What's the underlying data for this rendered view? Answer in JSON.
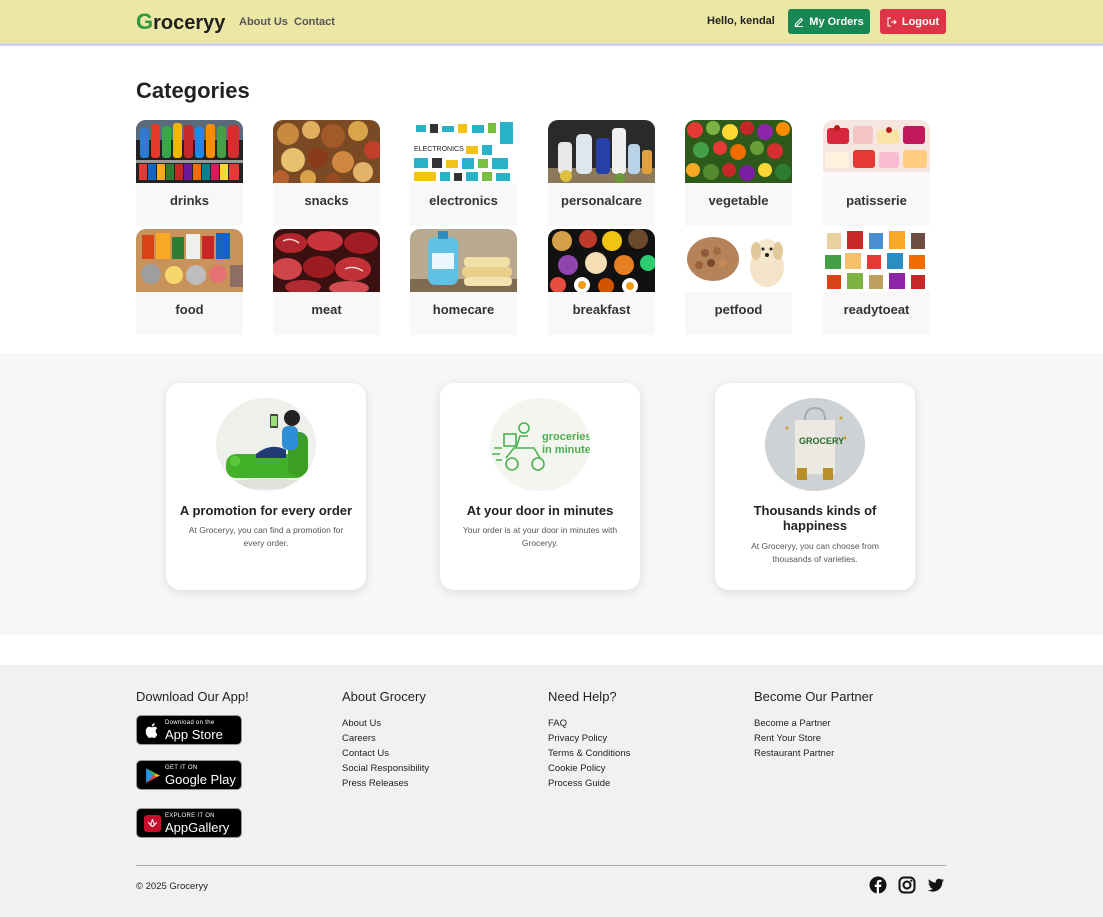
{
  "navbar": {
    "brand_first": "G",
    "brand_rest": "roceryy",
    "links": [
      "About Us",
      "Contact"
    ],
    "greeting": "Hello, kendal",
    "orders_label": "My Orders",
    "logout_label": "Logout"
  },
  "categories": {
    "title": "Categories",
    "items": [
      {
        "label": "drinks"
      },
      {
        "label": "snacks"
      },
      {
        "label": "electronics",
        "image_text": "ELECTRONICS"
      },
      {
        "label": "personalcare"
      },
      {
        "label": "vegetable"
      },
      {
        "label": "patisserie"
      },
      {
        "label": "food"
      },
      {
        "label": "meat"
      },
      {
        "label": "homecare"
      },
      {
        "label": "breakfast"
      },
      {
        "label": "petfood"
      },
      {
        "label": "readytoeat"
      }
    ]
  },
  "features": [
    {
      "title": "A promotion for every order",
      "desc": "At Groceryy, you can find a promotion for every order."
    },
    {
      "title": "At your door in minutes",
      "desc": "Your order is at your door in minutes with Groceryy.",
      "image_text_1": "groceries",
      "image_text_2": "in minutes"
    },
    {
      "title": "Thousands kinds of happiness",
      "desc": "At Groceryy, you can choose from thousands of varieties.",
      "image_text": "GROCERY"
    }
  ],
  "footer": {
    "app": {
      "heading": "Download Our App!",
      "stores": [
        {
          "small": "Download on the",
          "big": "App Store",
          "icon": "apple-icon"
        },
        {
          "small": "GET IT ON",
          "big": "Google Play",
          "icon": "google-play-icon"
        },
        {
          "small": "EXPLORE IT ON",
          "big": "AppGallery",
          "icon": "huawei-icon"
        }
      ]
    },
    "about": {
      "heading": "About Grocery",
      "links": [
        "About Us",
        "Careers",
        "Contact Us",
        "Social Responsibility",
        "Press Releases"
      ]
    },
    "help": {
      "heading": "Need Help?",
      "links": [
        "FAQ",
        "Privacy Policy",
        "Terms & Conditions",
        "Cookie Policy",
        "Process Guide"
      ]
    },
    "partner": {
      "heading": "Become Our Partner",
      "links": [
        "Become a Partner",
        "Rent Your Store",
        "Restaurant Partner"
      ]
    },
    "copyright": "© 2025 Groceryy",
    "social": [
      "facebook-icon",
      "instagram-icon",
      "twitter-icon"
    ]
  },
  "colors": {
    "navbar_bg": "#ede7a5",
    "brand_accent": "#2e9a3b",
    "orders_btn": "#198754",
    "logout_btn": "#dc3545"
  }
}
